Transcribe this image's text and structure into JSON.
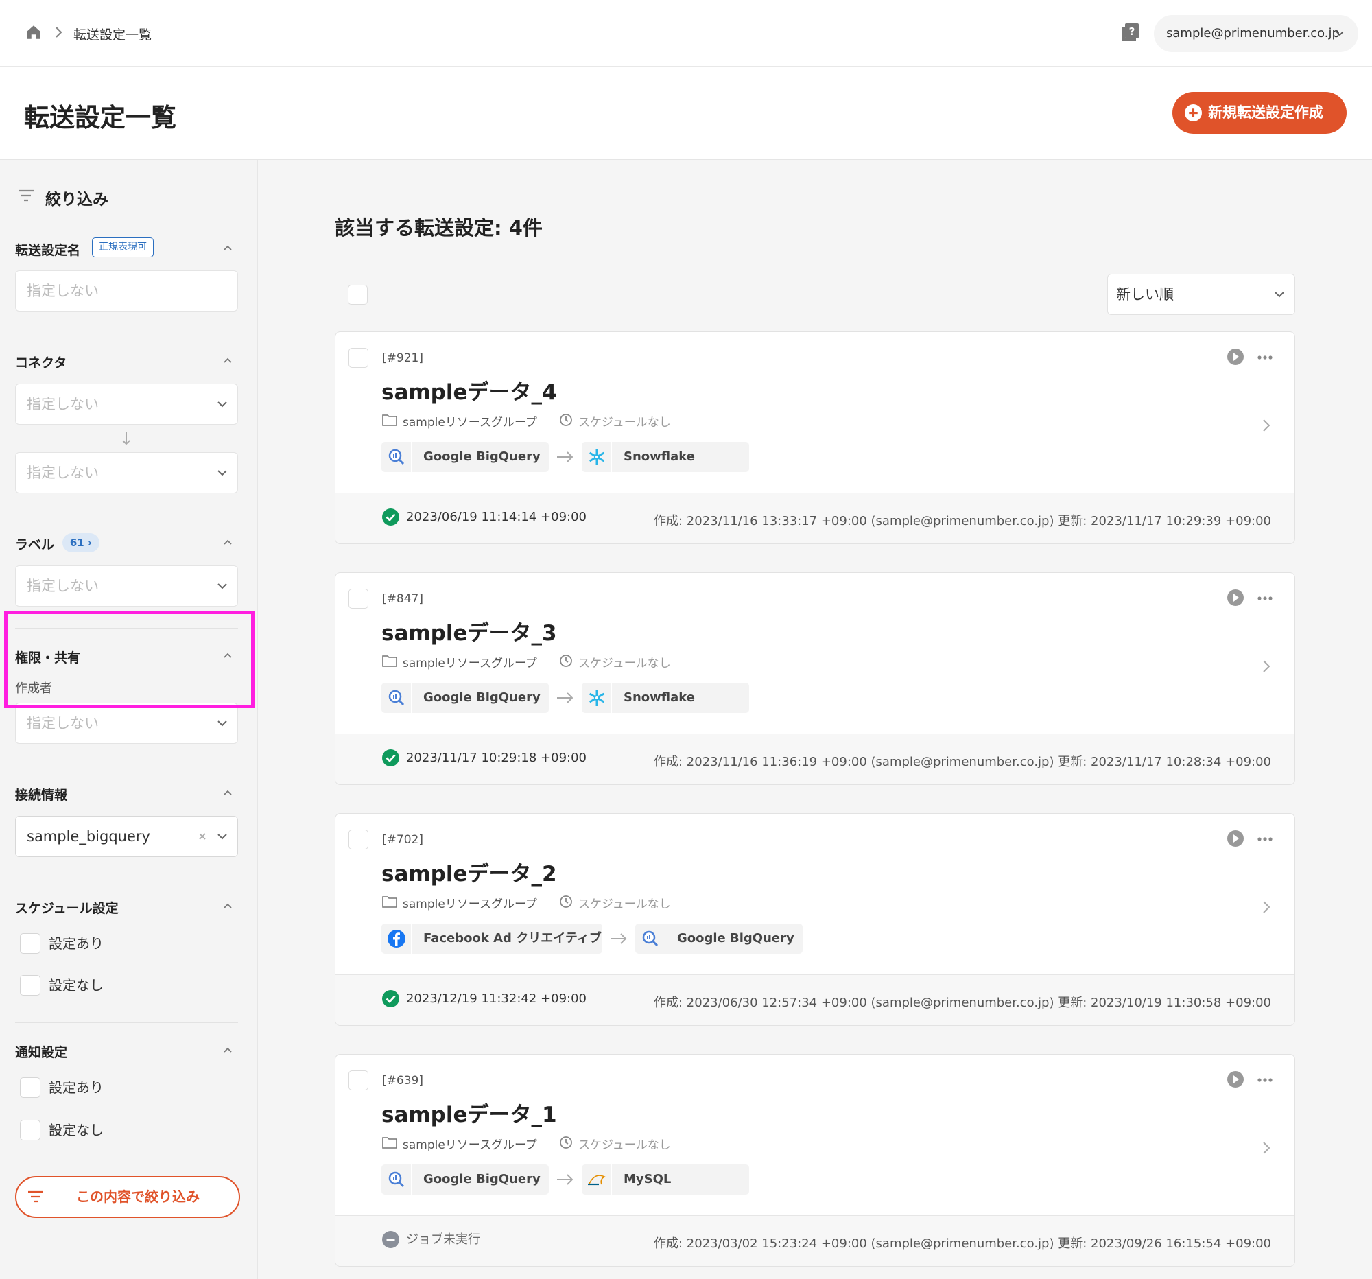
{
  "breadcrumb": {
    "current": "転送設定一覧"
  },
  "user": {
    "email": "sample@primenumber.co.jp"
  },
  "page": {
    "title": "転送設定一覧",
    "new_button": "新規転送設定作成"
  },
  "sidebar": {
    "filter_title": "絞り込み",
    "name_section": {
      "title": "転送設定名",
      "badge": "正規表現可",
      "placeholder": "指定しない"
    },
    "connector_section": {
      "title": "コネクタ",
      "source": "指定しない",
      "dest": "指定しない"
    },
    "label_section": {
      "title": "ラベル",
      "count": "61 ›",
      "value": "指定しない"
    },
    "permission_section": {
      "title": "権限・共有",
      "creator_label": "作成者",
      "creator_value": "指定しない"
    },
    "connection_section": {
      "title": "接続情報",
      "value": "sample_bigquery"
    },
    "schedule_section": {
      "title": "スケジュール設定",
      "opt1": "設定あり",
      "opt2": "設定なし"
    },
    "notify_section": {
      "title": "通知設定",
      "opt1": "設定あり",
      "opt2": "設定なし"
    },
    "apply_button": "この内容で絞り込み"
  },
  "main": {
    "count_text": "該当する転送設定: 4件",
    "sort": "新しい順"
  },
  "cards": [
    {
      "id": "[#921]",
      "title": "sampleデータ_4",
      "group": "sampleリソースグループ",
      "schedule": "スケジュールなし",
      "source": "Google BigQuery",
      "dest": "Snowflake",
      "status": "2023/06/19 11:14:14 +09:00",
      "info": "作成: 2023/11/16 13:33:17 +09:00 (sample@primenumber.co.jp)   更新: 2023/11/17 10:29:39 +09:00"
    },
    {
      "id": "[#847]",
      "title": "sampleデータ_3",
      "group": "sampleリソースグループ",
      "schedule": "スケジュールなし",
      "source": "Google BigQuery",
      "dest": "Snowflake",
      "status": "2023/11/17 10:29:18 +09:00",
      "info": "作成: 2023/11/16 11:36:19 +09:00 (sample@primenumber.co.jp)   更新: 2023/11/17 10:28:34 +09:00"
    },
    {
      "id": "[#702]",
      "title": "sampleデータ_2",
      "group": "sampleリソースグループ",
      "schedule": "スケジュールなし",
      "source": "Facebook Ad クリエイティブ",
      "dest": "Google BigQuery",
      "status": "2023/12/19 11:32:42 +09:00",
      "info": "作成: 2023/06/30 12:57:34 +09:00 (sample@primenumber.co.jp)   更新: 2023/10/19 11:30:58 +09:00"
    },
    {
      "id": "[#639]",
      "title": "sampleデータ_1",
      "group": "sampleリソースグループ",
      "schedule": "スケジュールなし",
      "source": "Google BigQuery",
      "dest": "MySQL",
      "status": "ジョブ未実行",
      "info": "作成: 2023/03/02 15:23:24 +09:00 (sample@primenumber.co.jp)   更新: 2023/09/26 16:15:54 +09:00"
    }
  ]
}
